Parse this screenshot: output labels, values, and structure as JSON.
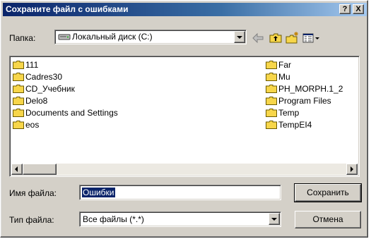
{
  "window": {
    "title": "Сохраните файл с ошибками",
    "help_label": "?",
    "close_label": "X"
  },
  "location": {
    "label": "Папка:",
    "value": "Локальный диск (C:)"
  },
  "toolbar": {
    "icons": [
      "back-arrow-icon",
      "up-folder-icon",
      "new-folder-icon",
      "view-menu-icon"
    ]
  },
  "files": {
    "col1": [
      "111",
      "Cadres30",
      "CD_Учебник",
      "Delo8",
      "Documents and Settings",
      "eos"
    ],
    "col2": [
      "Far",
      "Mu",
      "PH_MORPH.1_2",
      "Program Files",
      "Temp",
      "TempEI4"
    ]
  },
  "filename": {
    "label": "Имя файла:",
    "value": "Ошибки"
  },
  "filetype": {
    "label": "Тип файла:",
    "value": "Все файлы (*.*)"
  },
  "buttons": {
    "save": "Сохранить",
    "cancel": "Отмена"
  },
  "colors": {
    "title_bar": "#0a246a",
    "window_face": "#d4d0c8",
    "folder": "#f7d64a"
  }
}
